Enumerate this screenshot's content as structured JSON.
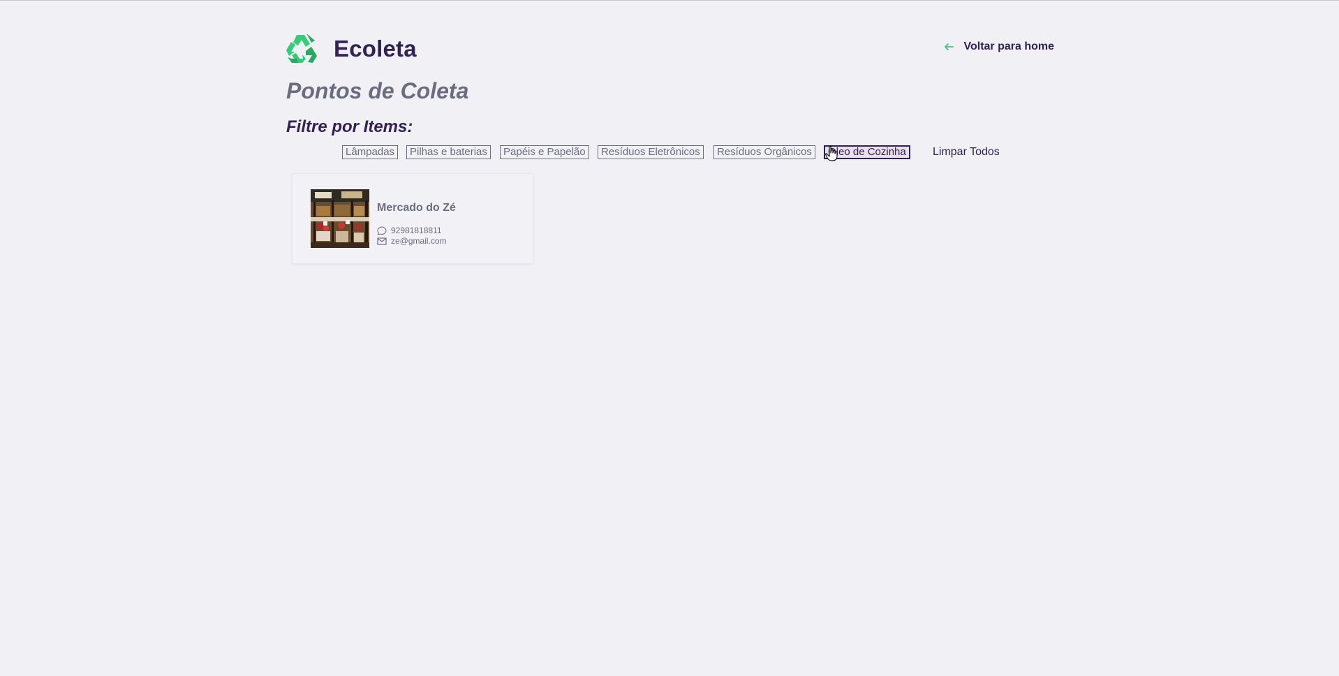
{
  "header": {
    "logo_text": "Ecoleta",
    "back_label": "Voltar para home"
  },
  "page_title": "Pontos de Coleta",
  "filter_title": "Filtre por Items:",
  "filters": [
    {
      "label": "Lâmpadas",
      "selected": false
    },
    {
      "label": "Pilhas e baterias",
      "selected": false
    },
    {
      "label": "Papéis e Papelão",
      "selected": false
    },
    {
      "label": "Resíduos Eletrônicos",
      "selected": false
    },
    {
      "label": "Resíduos Orgânicos",
      "selected": false
    },
    {
      "label": "Óleo de Cozinha",
      "selected": true
    }
  ],
  "clear_all_label": "Limpar Todos",
  "points": [
    {
      "name": "Mercado do Zé",
      "phone": "92981818811",
      "email": "ze@gmail.com"
    }
  ],
  "colors": {
    "brand_green": "#34cb79",
    "title_dark": "#322153",
    "text_gray": "#6c6c80",
    "background": "#f0f0f5"
  },
  "icons": [
    "recycle-logo-icon",
    "arrow-left-icon",
    "whatsapp-icon",
    "mail-icon",
    "hand-cursor-icon"
  ]
}
